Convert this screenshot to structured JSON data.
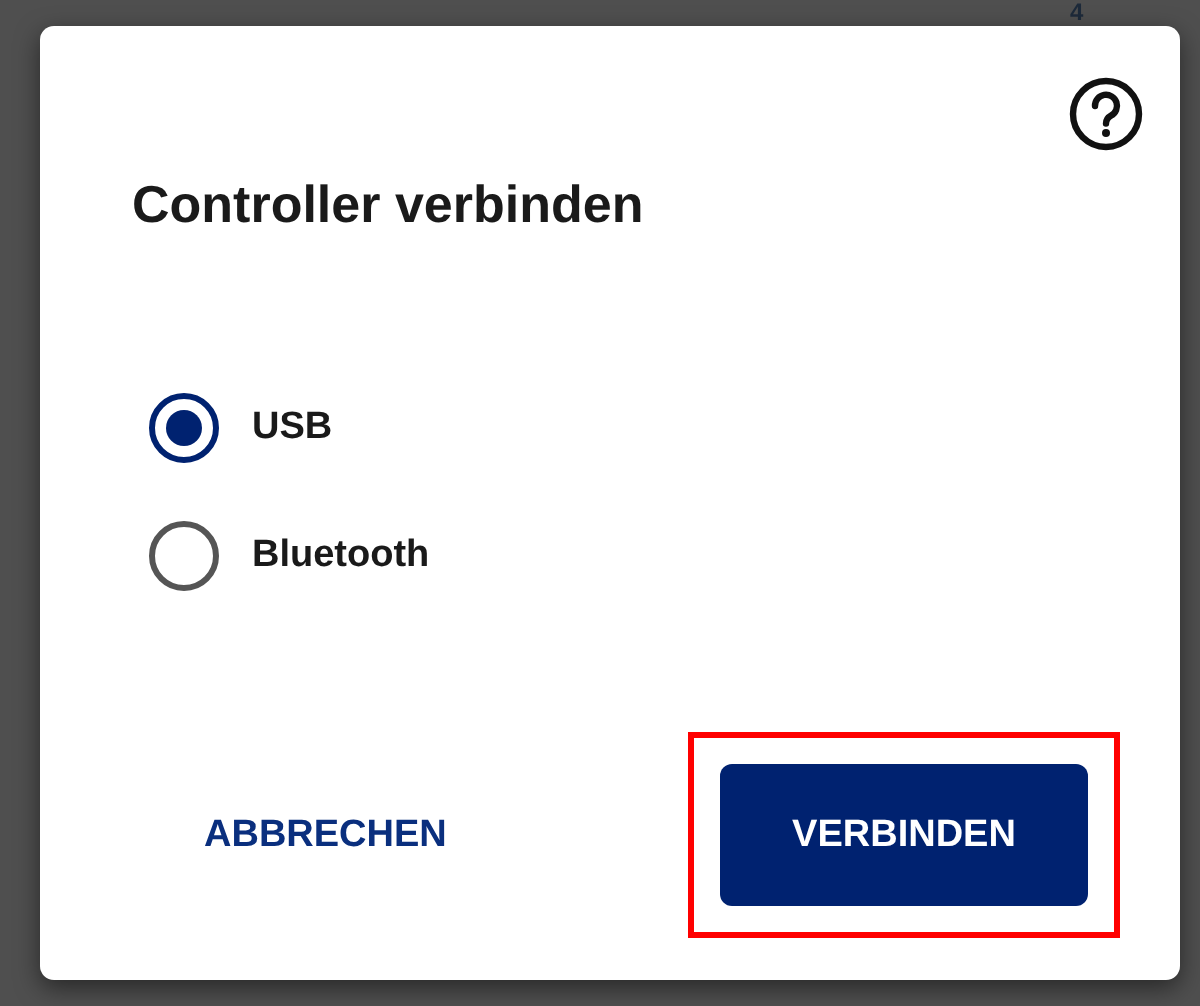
{
  "background": {
    "text": "4"
  },
  "dialog": {
    "title": "Controller verbinden",
    "options": [
      {
        "label": "USB",
        "selected": true
      },
      {
        "label": "Bluetooth",
        "selected": false
      }
    ],
    "buttons": [
      {
        "label": "ABBRECHEN",
        "kind": "text",
        "highlighted": false
      },
      {
        "label": "VERBINDEN",
        "kind": "filled",
        "highlighted": true
      }
    ]
  }
}
